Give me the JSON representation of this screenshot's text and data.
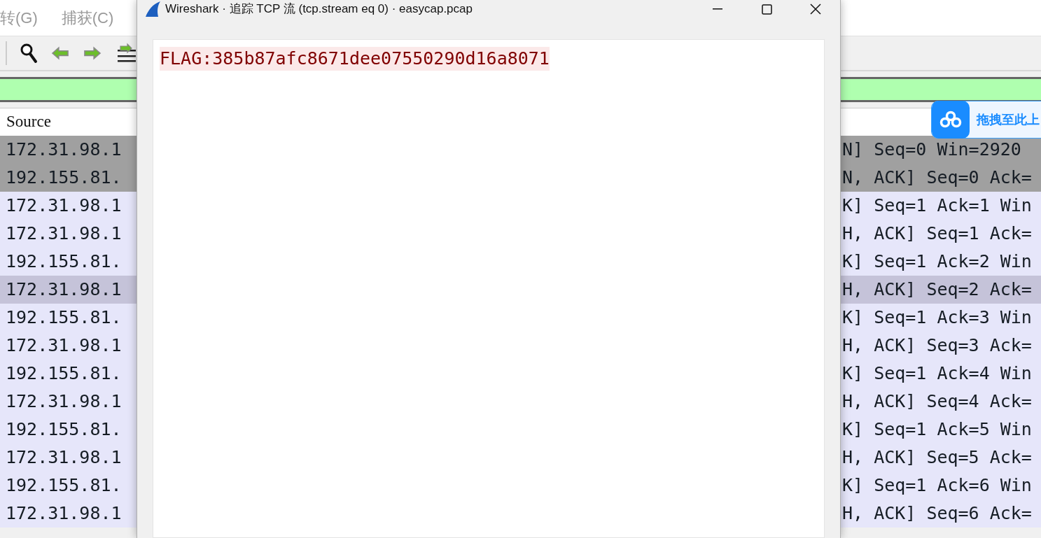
{
  "background_window": {
    "menu": [
      "转(G)",
      "捕获(C)"
    ],
    "column_header": "Source",
    "rows": [
      {
        "source": "172.31.98.1",
        "info": "N] Seq=0 Win=2920",
        "color": "#a0a0a0"
      },
      {
        "source": "192.155.81.",
        "info": "N, ACK] Seq=0 Ack=",
        "color": "#a0a0a0"
      },
      {
        "source": "172.31.98.1",
        "info": "K] Seq=1 Ack=1 Win",
        "color": "#e6e6fa"
      },
      {
        "source": "172.31.98.1",
        "info": "H, ACK] Seq=1 Ack=",
        "color": "#e6e6fa"
      },
      {
        "source": "192.155.81.",
        "info": "K] Seq=1 Ack=2 Win",
        "color": "#e6e6fa"
      },
      {
        "source": "172.31.98.1",
        "info": "H, ACK] Seq=2 Ack=",
        "color": "#c5c3d9"
      },
      {
        "source": "192.155.81.",
        "info": "K] Seq=1 Ack=3 Win",
        "color": "#e6e6fa"
      },
      {
        "source": "172.31.98.1",
        "info": "H, ACK] Seq=3 Ack=",
        "color": "#e6e6fa"
      },
      {
        "source": "192.155.81.",
        "info": "K] Seq=1 Ack=4 Win",
        "color": "#e6e6fa"
      },
      {
        "source": "172.31.98.1",
        "info": "H, ACK] Seq=4 Ack=",
        "color": "#e6e6fa"
      },
      {
        "source": "192.155.81.",
        "info": "K] Seq=1 Ack=5 Win",
        "color": "#e6e6fa"
      },
      {
        "source": "172.31.98.1",
        "info": "H, ACK] Seq=5 Ack=",
        "color": "#e6e6fa"
      },
      {
        "source": "192.155.81.",
        "info": "K] Seq=1 Ack=6 Win",
        "color": "#e6e6fa"
      },
      {
        "source": "172.31.98.1",
        "info": "H, ACK] Seq=6 Ack=",
        "color": "#e6e6fa"
      }
    ]
  },
  "upload_widget": {
    "label": "拖拽至此上"
  },
  "dialog": {
    "title": "Wireshark · 追踪 TCP 流 (tcp.stream eq 0) · easycap.pcap",
    "stream_text": "FLAG:385b87afc8671dee07550290d16a8071"
  }
}
